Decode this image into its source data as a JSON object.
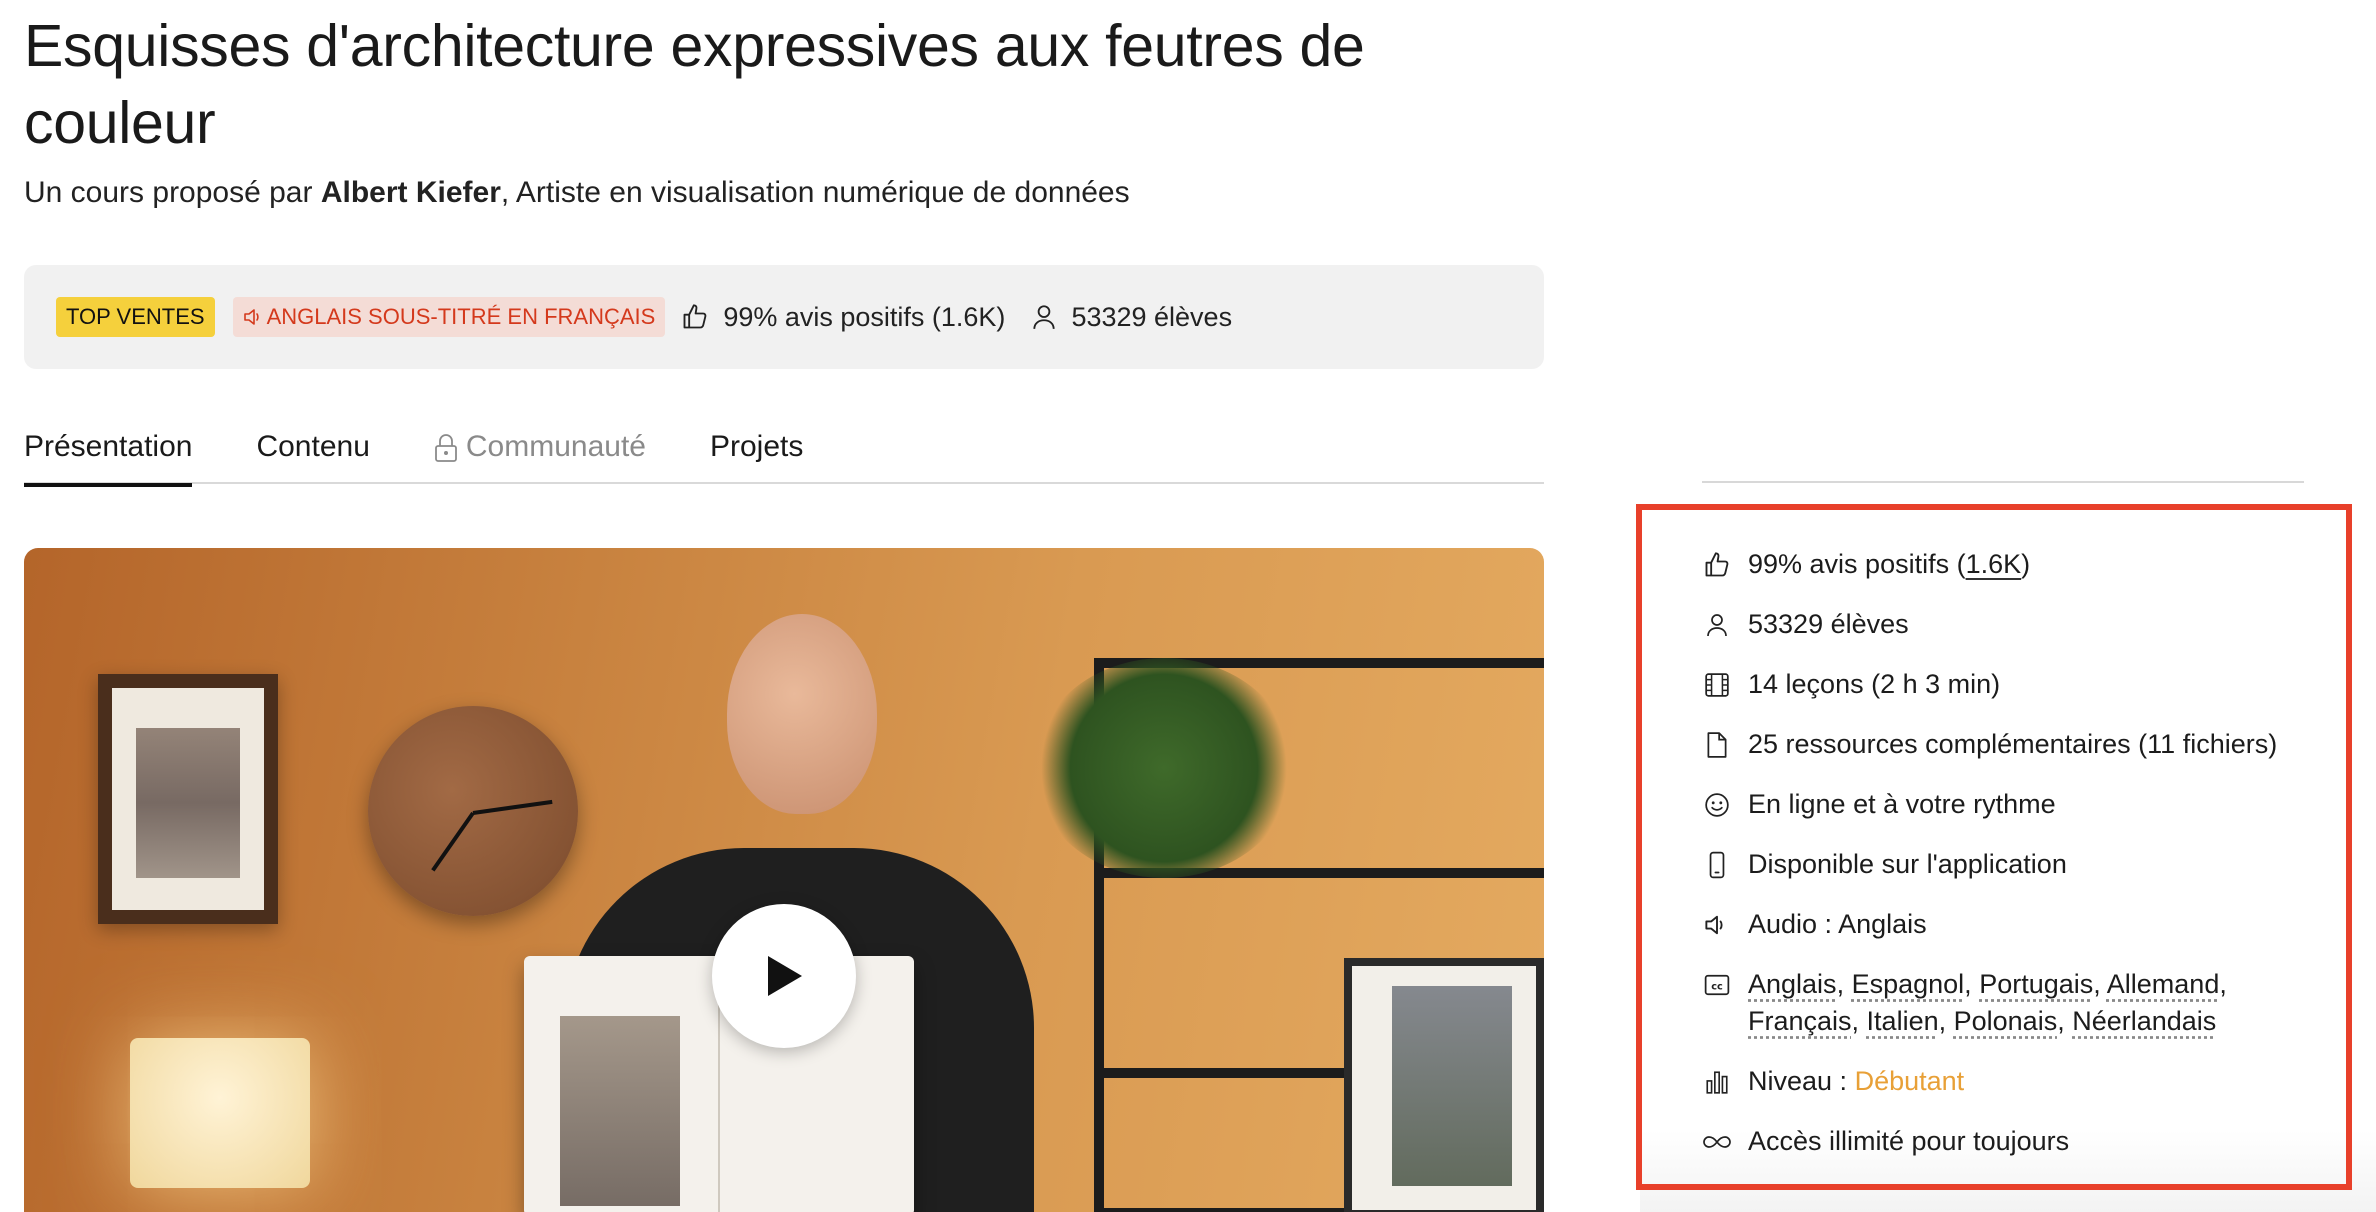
{
  "course": {
    "title": "Esquisses d'architecture expressives aux feutres de couleur",
    "subtitle_prefix": "Un cours proposé par",
    "author": "Albert Kiefer",
    "subtitle_suffix": ", Artiste en visualisation numérique de données"
  },
  "stats_bar": {
    "badge_top": "TOP VENTES",
    "badge_audio": "ANGLAIS SOUS-TITRÉ EN FRANÇAIS",
    "reviews": "99% avis positifs (1.6K)",
    "students": "53329 élèves"
  },
  "tabs": [
    {
      "label": "Présentation",
      "active": true
    },
    {
      "label": "Contenu"
    },
    {
      "label": "Communauté",
      "locked": true
    },
    {
      "label": "Projets"
    }
  ],
  "sidebar": {
    "reviews_prefix": "99% avis positifs (",
    "reviews_link": "1.6K",
    "reviews_suffix": ")",
    "students": "53329 élèves",
    "lessons": "14 leçons (2 h 3 min)",
    "resources": "25 ressources complémentaires (11 fichiers)",
    "pace": "En ligne et à votre rythme",
    "app": "Disponible sur l'application",
    "audio": "Audio : Anglais",
    "subtitles": [
      "Anglais",
      "Espagnol",
      "Portugais",
      "Allemand",
      "Français",
      "Italien",
      "Polonais",
      "Néerlandais"
    ],
    "level_label": "Niveau :",
    "level_value": "Débutant",
    "access": "Accès illimité pour toujours"
  },
  "colors": {
    "badge_top_bg": "#f5d03c",
    "badge_audio_text": "#d4391c",
    "level": "#e8a037",
    "highlight_border": "#e8402a"
  },
  "icons": [
    "thumbs-up-icon",
    "user-icon",
    "speaker-icon",
    "lock-icon",
    "play-icon",
    "film-icon",
    "document-icon",
    "smiley-icon",
    "phone-icon",
    "closed-captions-icon",
    "bar-chart-icon",
    "infinity-icon"
  ]
}
